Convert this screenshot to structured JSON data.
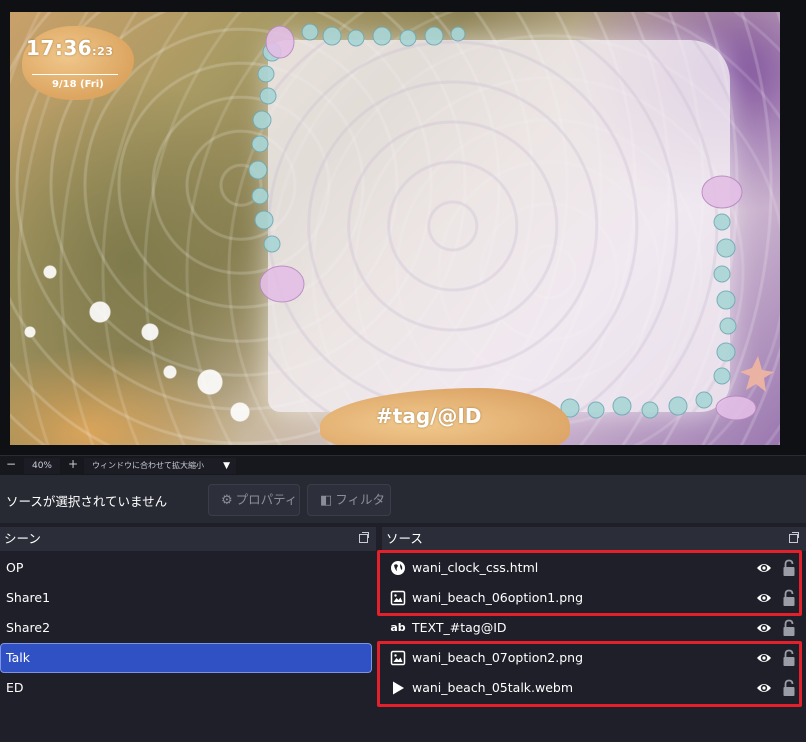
{
  "preview": {
    "clock": {
      "time": "17:36",
      "seconds": "23",
      "date": "9/18 (Fri)"
    },
    "tag_text": "#tag/@ID"
  },
  "zoom": {
    "minus": "−",
    "value": "40%",
    "plus": "+",
    "fit_label": "ウィンドウに合わせて拡大縮小"
  },
  "context_bar": {
    "no_source_text": "ソースが選択されていません",
    "properties_label": "プロパティ",
    "filters_label": "フィルタ"
  },
  "scenes": {
    "title": "シーン",
    "items": [
      {
        "label": "OP",
        "selected": false
      },
      {
        "label": "Share1",
        "selected": false
      },
      {
        "label": "Share2",
        "selected": false
      },
      {
        "label": "Talk",
        "selected": true
      },
      {
        "label": "ED",
        "selected": false
      }
    ]
  },
  "sources": {
    "title": "ソース",
    "items": [
      {
        "label": "wani_clock_css.html",
        "icon": "globe-icon"
      },
      {
        "label": "wani_beach_06option1.png",
        "icon": "image-icon"
      },
      {
        "label": "TEXT_#tag@ID",
        "icon": "text-ab-icon"
      },
      {
        "label": "wani_beach_07option2.png",
        "icon": "image-icon"
      },
      {
        "label": "wani_beach_05talk.webm",
        "icon": "play-icon"
      }
    ]
  },
  "colors": {
    "highlight": "#e3202b",
    "selection": "#2f51c4",
    "background": "#1e1f29"
  }
}
